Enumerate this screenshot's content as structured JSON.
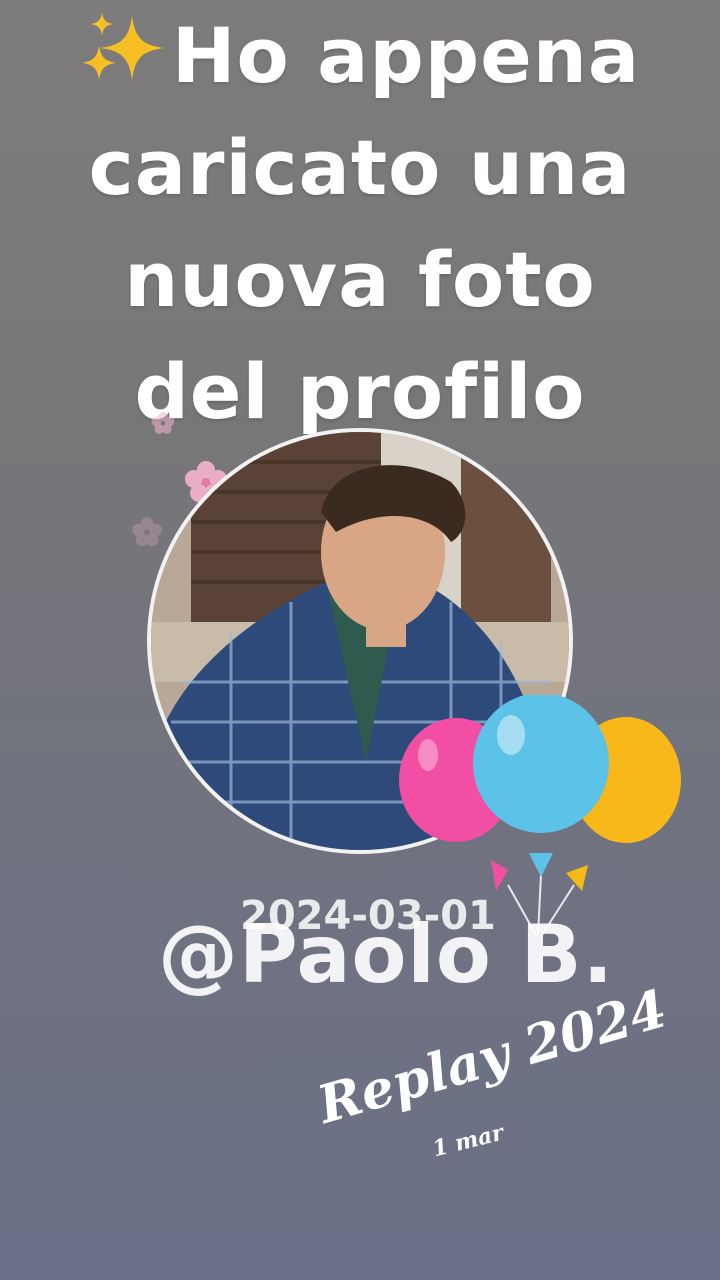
{
  "headline": {
    "line1": "Ho appena",
    "line2": "caricato una",
    "line3": "nuova foto",
    "line4": "del profilo",
    "emoji": "sparkles-icon"
  },
  "profile": {
    "date": "2024-03-01",
    "username": "@Paolo B."
  },
  "replay": {
    "title": "Replay 2024",
    "date": "1 mar"
  },
  "decorations": {
    "balloon_colors": [
      "#f24fa4",
      "#5cc2e8",
      "#f8b81a"
    ]
  }
}
